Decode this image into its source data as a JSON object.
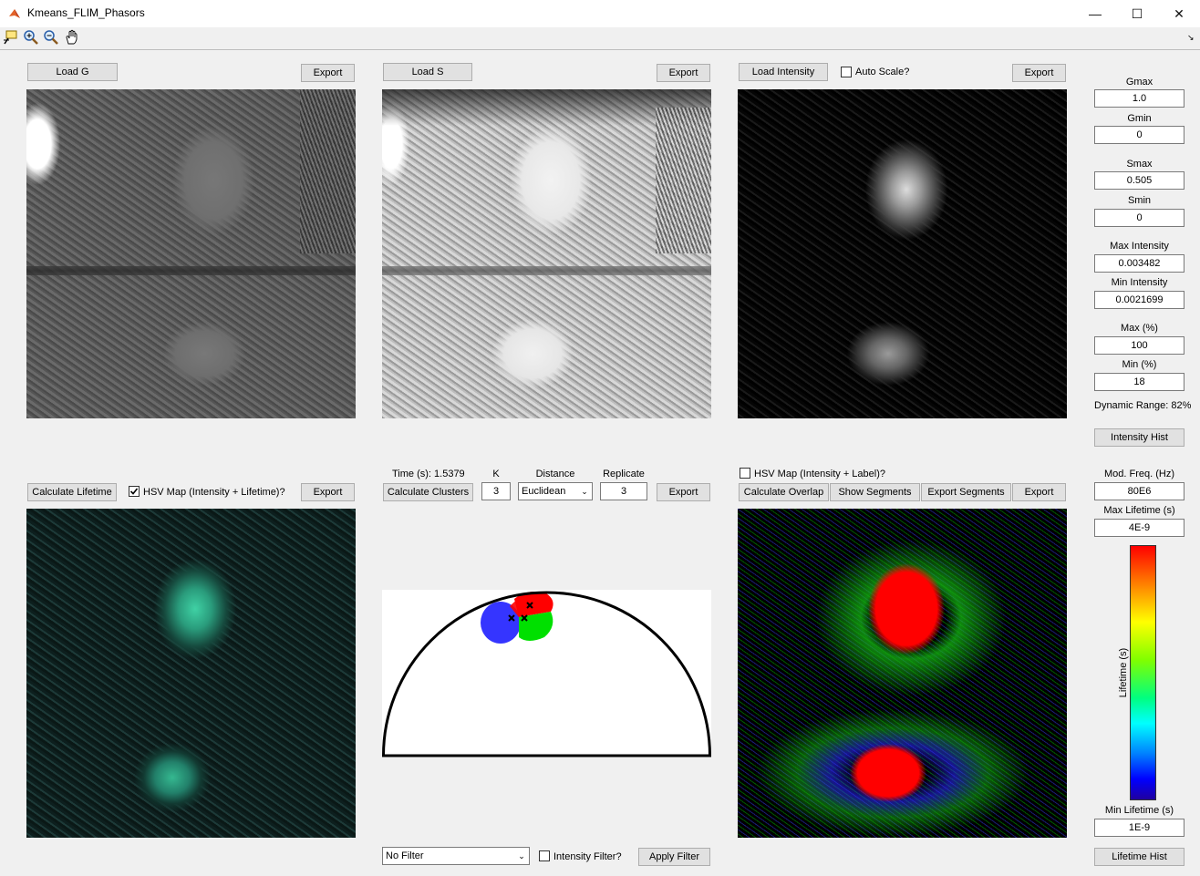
{
  "window": {
    "title": "Kmeans_FLIM_Phasors",
    "minimize": "—",
    "maximize": "☐",
    "close": "✕"
  },
  "toolbar": {
    "tools": [
      "data-cursor-icon",
      "zoom-in-icon",
      "zoom-out-icon",
      "pan-hand-icon"
    ]
  },
  "panel_g": {
    "load_label": "Load G",
    "export_label": "Export"
  },
  "panel_s": {
    "load_label": "Load S",
    "export_label": "Export"
  },
  "panel_intensity": {
    "load_label": "Load Intensity",
    "autoscale_label": "Auto Scale?",
    "autoscale_checked": false,
    "export_label": "Export"
  },
  "panel_lifetime": {
    "calc_label": "Calculate Lifetime",
    "hsv_label": "HSV Map (Intensity + Lifetime)?",
    "hsv_checked": true,
    "export_label": "Export"
  },
  "panel_cluster": {
    "time_label": "Time (s): 1.5379",
    "k_label": "K",
    "k_value": "3",
    "distance_label": "Distance",
    "distance_value": "Euclidean",
    "replicate_label": "Replicate",
    "replicate_value": "3",
    "calc_label": "Calculate Clusters",
    "export_label": "Export"
  },
  "panel_overlay": {
    "hsv_label": "HSV Map (Intensity + Label)?",
    "hsv_checked": false,
    "calc_overlay_label": "Calculate Overlap",
    "show_segments_label": "Show Segments",
    "export_segments_label": "Export Segments",
    "export_label": "Export"
  },
  "filter": {
    "value": "No Filter",
    "intensity_filter_label": "Intensity Filter?",
    "intensity_filter_checked": false,
    "apply_label": "Apply Filter"
  },
  "sidebar": {
    "gmax_label": "Gmax",
    "gmax_value": "1.0",
    "gmin_label": "Gmin",
    "gmin_value": "0",
    "smax_label": "Smax",
    "smax_value": "0.505",
    "smin_label": "Smin",
    "smin_value": "0",
    "max_intensity_label": "Max Intensity",
    "max_intensity_value": "0.003482",
    "min_intensity_label": "Min Intensity",
    "min_intensity_value": "0.0021699",
    "max_pct_label": "Max (%)",
    "max_pct_value": "100",
    "min_pct_label": "Min (%)",
    "min_pct_value": "18",
    "dynamic_range": "Dynamic Range: 82%",
    "intensity_hist_label": "Intensity Hist",
    "mod_freq_label": "Mod. Freq. (Hz)",
    "mod_freq_value": "80E6",
    "max_lifetime_label": "Max Lifetime (s)",
    "max_lifetime_value": "4E-9",
    "colorbar_label": "Lifetime (s)",
    "min_lifetime_label": "Min Lifetime (s)",
    "min_lifetime_value": "1E-9",
    "lifetime_hist_label": "Lifetime Hist"
  },
  "colors": {
    "cluster_red": "#ff0000",
    "cluster_green": "#00e000",
    "cluster_blue": "#2a2aff",
    "lifetime_tint": "#2ee6b0"
  }
}
